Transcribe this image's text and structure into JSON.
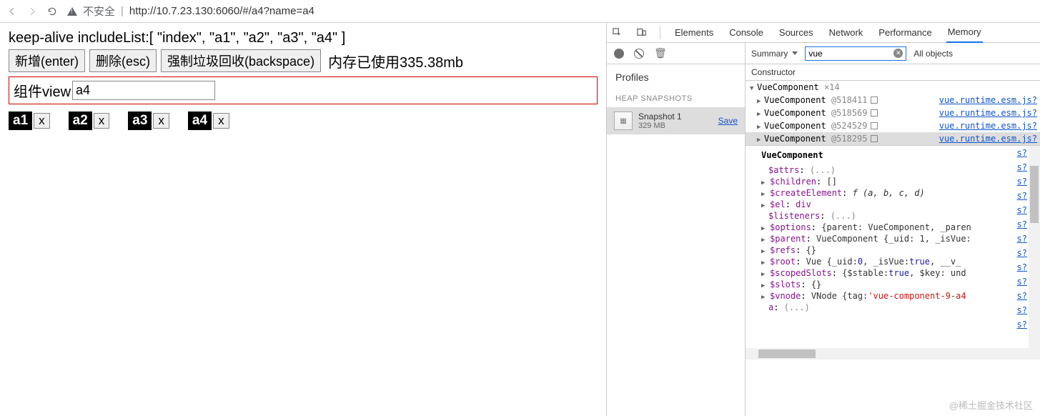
{
  "browser": {
    "insecure_label": "不安全",
    "url": "http://10.7.23.130:6060/#/a4?name=a4"
  },
  "page": {
    "include_line": "keep-alive includeList:[ \"index\", \"a1\", \"a2\", \"a3\", \"a4\" ]",
    "buttons": {
      "add": "新增(enter)",
      "del": "删除(esc)",
      "gc": "强制垃圾回收(backspace)"
    },
    "mem_text": "内存已使用335.38mb",
    "view_label": "组件view",
    "view_value": "a4",
    "tabs": [
      {
        "label": "a1",
        "close": "x"
      },
      {
        "label": "a2",
        "close": "x"
      },
      {
        "label": "a3",
        "close": "x"
      },
      {
        "label": "a4",
        "close": "x"
      }
    ]
  },
  "devtools": {
    "tabs": {
      "elements": "Elements",
      "console": "Console",
      "sources": "Sources",
      "network": "Network",
      "performance": "Performance",
      "memory": "Memory"
    },
    "profiles": {
      "title": "Profiles",
      "heap_label": "HEAP SNAPSHOTS",
      "snapshot": {
        "title": "Snapshot 1",
        "size": "329 MB",
        "save": "Save"
      }
    },
    "memory": {
      "summary": "Summary",
      "filter": "vue",
      "all_objects": "All objects",
      "constructor_header": "Constructor",
      "root": {
        "name": "VueComponent",
        "count": "×14"
      },
      "instances": [
        {
          "name": "VueComponent",
          "id": "@518411",
          "link": "vue.runtime.esm.js?"
        },
        {
          "name": "VueComponent",
          "id": "@518569",
          "link": "vue.runtime.esm.js?"
        },
        {
          "name": "VueComponent",
          "id": "@524529",
          "link": "vue.runtime.esm.js?"
        },
        {
          "name": "VueComponent",
          "id": "@518295",
          "link": "vue.runtime.esm.js?"
        }
      ],
      "detail_title": "VueComponent",
      "detail": {
        "attrs": {
          "k": "$attrs",
          "v": "(...)"
        },
        "children": {
          "k": "$children",
          "v": "[]"
        },
        "createElement": {
          "k": "$createElement",
          "v": "f (a, b, c, d)"
        },
        "el": {
          "k": "$el",
          "v": "div"
        },
        "listeners": {
          "k": "$listeners",
          "v": "(...)"
        },
        "options": {
          "k": "$options",
          "v": "{parent: VueComponent, _paren"
        },
        "parent": {
          "k": "$parent",
          "v": "VueComponent {_uid: 1, _isVue:"
        },
        "refs": {
          "k": "$refs",
          "v": "{}"
        },
        "root": {
          "k": "$root",
          "v1": "Vue {_uid: ",
          "num0": "0",
          "v2": ", _isVue: ",
          "t": "true",
          "v3": ", __v_"
        },
        "scopedSlots": {
          "k": "$scopedSlots",
          "v1": "{$stable: ",
          "t": "true",
          "v2": ", $key: und"
        },
        "slots": {
          "k": "$slots",
          "v": "{}"
        },
        "vnode": {
          "k": "$vnode",
          "v1": "VNode {tag: ",
          "s": "'vue-component-9-a4"
        },
        "a": {
          "k": "a",
          "v": "(...)"
        }
      },
      "side_links": [
        "s?",
        "s?",
        "s?",
        "s?",
        "s?",
        "s?",
        "s?",
        "s?",
        "s?",
        "s?",
        "s?",
        "s?",
        "s?"
      ]
    }
  },
  "watermark": "@稀土掘金技术社区"
}
